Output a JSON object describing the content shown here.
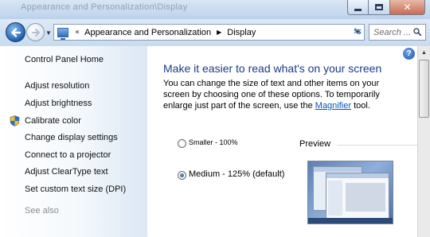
{
  "window": {
    "title": "Appearance and Personalization\\Display",
    "buttons": {
      "minimize": "minimize",
      "maximize": "maximize",
      "close": "close"
    }
  },
  "nav": {
    "back_icon": "back-arrow-icon",
    "forward_icon": "forward-arrow-icon",
    "breadcrumb_prefix": "«",
    "breadcrumbs": [
      "Appearance and Personalization",
      "Display"
    ],
    "search_placeholder": "Search ..."
  },
  "sidebar": {
    "home": "Control Panel Home",
    "items": [
      "Adjust resolution",
      "Adjust brightness",
      "Calibrate color",
      "Change display settings",
      "Connect to a projector",
      "Adjust ClearType text",
      "Set custom text size (DPI)"
    ],
    "see_also": "See also"
  },
  "main": {
    "heading": "Make it easier to read what's on your screen",
    "description_before": "You can change the size of text and other items on your screen by choosing one of these options. To temporarily enlarge just part of the screen, use the ",
    "magnifier_link": "Magnifier",
    "description_after": " tool.",
    "options": [
      {
        "label": "Smaller - 100%",
        "checked": false
      },
      {
        "label": "Medium - 125% (default)",
        "checked": true
      }
    ],
    "preview_label": "Preview"
  },
  "colors": {
    "heading": "#1e3a8a",
    "link": "#0654b8",
    "sidebar_text": "#101010"
  }
}
